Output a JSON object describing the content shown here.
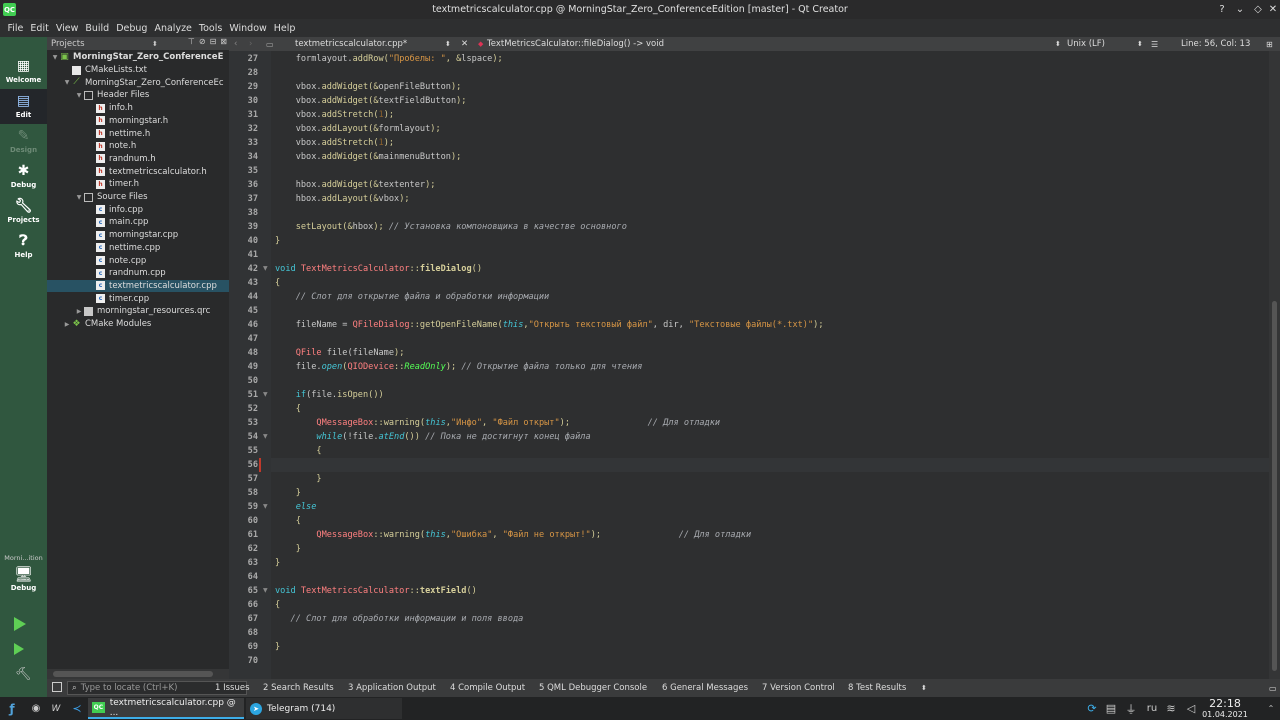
{
  "window": {
    "title": "textmetricscalculator.cpp @ MorningStar_Zero_ConferenceEdition [master] - Qt Creator",
    "app_icon": "qt-creator-icon"
  },
  "menu": [
    "File",
    "Edit",
    "View",
    "Build",
    "Debug",
    "Analyze",
    "Tools",
    "Window",
    "Help"
  ],
  "modes": [
    {
      "label": "Welcome",
      "icon": "grid-icon",
      "state": "normal"
    },
    {
      "label": "Edit",
      "icon": "document-icon",
      "state": "active"
    },
    {
      "label": "Design",
      "icon": "pen-icon",
      "state": "disabled"
    },
    {
      "label": "Debug",
      "icon": "bug-icon",
      "state": "normal"
    },
    {
      "label": "Projects",
      "icon": "wrench-icon",
      "state": "normal"
    },
    {
      "label": "Help",
      "icon": "help-icon",
      "state": "normal"
    }
  ],
  "kit_selector": {
    "project": "Morni...ition",
    "config": "Debug"
  },
  "projects_panel": {
    "header": "Projects",
    "tree": [
      {
        "label": "MorningStar_Zero_ConferenceE",
        "depth": 0,
        "arrow": "down",
        "icon": "qt-icon",
        "bold": true
      },
      {
        "label": "CMakeLists.txt",
        "depth": 1,
        "arrow": "",
        "icon": "cmake-file"
      },
      {
        "label": "MorningStar_Zero_ConferenceEc",
        "depth": 1,
        "arrow": "down",
        "icon": "target"
      },
      {
        "label": "Header Files",
        "depth": 2,
        "arrow": "down",
        "icon": "folder"
      },
      {
        "label": "info.h",
        "depth": 3,
        "arrow": "",
        "icon": "h"
      },
      {
        "label": "morningstar.h",
        "depth": 3,
        "arrow": "",
        "icon": "h"
      },
      {
        "label": "nettime.h",
        "depth": 3,
        "arrow": "",
        "icon": "h"
      },
      {
        "label": "note.h",
        "depth": 3,
        "arrow": "",
        "icon": "h"
      },
      {
        "label": "randnum.h",
        "depth": 3,
        "arrow": "",
        "icon": "h"
      },
      {
        "label": "textmetricscalculator.h",
        "depth": 3,
        "arrow": "",
        "icon": "h"
      },
      {
        "label": "timer.h",
        "depth": 3,
        "arrow": "",
        "icon": "h"
      },
      {
        "label": "Source Files",
        "depth": 2,
        "arrow": "down",
        "icon": "folder"
      },
      {
        "label": "info.cpp",
        "depth": 3,
        "arrow": "",
        "icon": "c"
      },
      {
        "label": "main.cpp",
        "depth": 3,
        "arrow": "",
        "icon": "c"
      },
      {
        "label": "morningstar.cpp",
        "depth": 3,
        "arrow": "",
        "icon": "c"
      },
      {
        "label": "nettime.cpp",
        "depth": 3,
        "arrow": "",
        "icon": "c"
      },
      {
        "label": "note.cpp",
        "depth": 3,
        "arrow": "",
        "icon": "c"
      },
      {
        "label": "randnum.cpp",
        "depth": 3,
        "arrow": "",
        "icon": "c"
      },
      {
        "label": "textmetricscalculator.cpp",
        "depth": 3,
        "arrow": "",
        "icon": "c",
        "selected": true
      },
      {
        "label": "timer.cpp",
        "depth": 3,
        "arrow": "",
        "icon": "c"
      },
      {
        "label": "morningstar_resources.qrc",
        "depth": 2,
        "arrow": "right",
        "icon": "qrc"
      },
      {
        "label": "CMake Modules",
        "depth": 1,
        "arrow": "right",
        "icon": "cmake-modules"
      }
    ]
  },
  "editor": {
    "file_tab": "textmetricscalculator.cpp*",
    "symbol": "TextMetricsCalculator::fileDialog() -> void",
    "encoding": "Unix (LF)",
    "position": "Line: 56, Col: 13",
    "current_line": 56,
    "fold_markers": {
      "42": "open",
      "51": "open",
      "54": "open",
      "59": "open",
      "65": "open"
    },
    "lines": [
      {
        "n": 27,
        "t": [
          [
            "    formlayout.",
            "f"
          ],
          [
            "addRow",
            "fn"
          ],
          [
            "(",
            "pn"
          ],
          [
            "\"Пробелы: \"",
            "st"
          ],
          [
            ", &",
            "pn"
          ],
          [
            "lspace",
            "f"
          ],
          [
            ");",
            "pn"
          ]
        ]
      },
      {
        "n": 28,
        "t": []
      },
      {
        "n": 29,
        "t": [
          [
            "    vbox.",
            "f"
          ],
          [
            "addWidget",
            "fn"
          ],
          [
            "(&",
            "pn"
          ],
          [
            "openFileButton",
            "f"
          ],
          [
            ");",
            "pn"
          ]
        ]
      },
      {
        "n": 30,
        "t": [
          [
            "    vbox.",
            "f"
          ],
          [
            "addWidget",
            "fn"
          ],
          [
            "(&",
            "pn"
          ],
          [
            "textFieldButton",
            "f"
          ],
          [
            ");",
            "pn"
          ]
        ]
      },
      {
        "n": 31,
        "t": [
          [
            "    vbox.",
            "f"
          ],
          [
            "addStretch",
            "fn"
          ],
          [
            "(",
            "pn"
          ],
          [
            "1",
            "num"
          ],
          [
            ");",
            "pn"
          ]
        ]
      },
      {
        "n": 32,
        "t": [
          [
            "    vbox.",
            "f"
          ],
          [
            "addLayout",
            "fn"
          ],
          [
            "(&",
            "pn"
          ],
          [
            "formlayout",
            "f"
          ],
          [
            ");",
            "pn"
          ]
        ]
      },
      {
        "n": 33,
        "t": [
          [
            "    vbox.",
            "f"
          ],
          [
            "addStretch",
            "fn"
          ],
          [
            "(",
            "pn"
          ],
          [
            "1",
            "num"
          ],
          [
            ");",
            "pn"
          ]
        ]
      },
      {
        "n": 34,
        "t": [
          [
            "    vbox.",
            "f"
          ],
          [
            "addWidget",
            "fn"
          ],
          [
            "(&",
            "pn"
          ],
          [
            "mainmenuButton",
            "f"
          ],
          [
            ");",
            "pn"
          ]
        ]
      },
      {
        "n": 35,
        "t": []
      },
      {
        "n": 36,
        "t": [
          [
            "    hbox.",
            "f"
          ],
          [
            "addWidget",
            "fn"
          ],
          [
            "(&",
            "pn"
          ],
          [
            "textenter",
            "f"
          ],
          [
            ");",
            "pn"
          ]
        ]
      },
      {
        "n": 37,
        "t": [
          [
            "    hbox.",
            "f"
          ],
          [
            "addLayout",
            "fn"
          ],
          [
            "(&",
            "pn"
          ],
          [
            "vbox",
            "f"
          ],
          [
            ");",
            "pn"
          ]
        ]
      },
      {
        "n": 38,
        "t": []
      },
      {
        "n": 39,
        "t": [
          [
            "    ",
            "pn"
          ],
          [
            "setLayout",
            "fn"
          ],
          [
            "(&",
            "pn"
          ],
          [
            "hbox",
            "f"
          ],
          [
            "); ",
            "pn"
          ],
          [
            "// Установка компоновщика в качестве основного",
            "cm"
          ]
        ]
      },
      {
        "n": 40,
        "t": [
          [
            "}",
            "pn"
          ]
        ]
      },
      {
        "n": 41,
        "t": []
      },
      {
        "n": 42,
        "t": [
          [
            "void ",
            "kw"
          ],
          [
            "TextMetricsCalculator",
            "ty"
          ],
          [
            "::",
            "pn"
          ],
          [
            "fileDialog",
            "fnb"
          ],
          [
            "()",
            "pn"
          ]
        ]
      },
      {
        "n": 43,
        "t": [
          [
            "{",
            "pn"
          ]
        ]
      },
      {
        "n": 44,
        "t": [
          [
            "    ",
            "pn"
          ],
          [
            "// Слот для открытие файла и обработки информации",
            "cm"
          ]
        ]
      },
      {
        "n": 45,
        "t": []
      },
      {
        "n": 46,
        "t": [
          [
            "    fileName = ",
            "f"
          ],
          [
            "QFileDialog",
            "ty"
          ],
          [
            "::",
            "pn"
          ],
          [
            "getOpenFileName",
            "fn"
          ],
          [
            "(",
            "pn"
          ],
          [
            "this",
            "kwi"
          ],
          [
            ",",
            "pn"
          ],
          [
            "\"Открыть текстовый файл\"",
            "st"
          ],
          [
            ", dir, ",
            "f"
          ],
          [
            "\"Текстовые файлы(*.txt)\"",
            "st"
          ],
          [
            ");",
            "pn"
          ]
        ]
      },
      {
        "n": 47,
        "t": []
      },
      {
        "n": 48,
        "t": [
          [
            "    ",
            "pn"
          ],
          [
            "QFile",
            "ty"
          ],
          [
            " file(",
            "f"
          ],
          [
            "fileName",
            "f"
          ],
          [
            ");",
            "pn"
          ]
        ]
      },
      {
        "n": 49,
        "t": [
          [
            "    file.",
            "f"
          ],
          [
            "open",
            "kwi"
          ],
          [
            "(",
            "pn"
          ],
          [
            "QIODevice",
            "ty"
          ],
          [
            "::",
            "pn"
          ],
          [
            "ReadOnly",
            "en"
          ],
          [
            "); ",
            "pn"
          ],
          [
            "// Открытие файла только для чтения",
            "cm"
          ]
        ]
      },
      {
        "n": 50,
        "t": []
      },
      {
        "n": 51,
        "t": [
          [
            "    ",
            "pn"
          ],
          [
            "if",
            "kw"
          ],
          [
            "(file.",
            "f"
          ],
          [
            "isOpen",
            "fn"
          ],
          [
            "())",
            "pn"
          ]
        ]
      },
      {
        "n": 52,
        "t": [
          [
            "    {",
            "pn"
          ]
        ]
      },
      {
        "n": 53,
        "t": [
          [
            "        ",
            "pn"
          ],
          [
            "QMessageBox",
            "ty"
          ],
          [
            "::",
            "pn"
          ],
          [
            "warning",
            "fn"
          ],
          [
            "(",
            "pn"
          ],
          [
            "this",
            "kwi"
          ],
          [
            ",",
            "pn"
          ],
          [
            "\"Инфо\"",
            "st"
          ],
          [
            ", ",
            "pn"
          ],
          [
            "\"Файл открыт\"",
            "st"
          ],
          [
            ");               ",
            "pn"
          ],
          [
            "// Для отладки",
            "cm"
          ]
        ]
      },
      {
        "n": 54,
        "t": [
          [
            "        ",
            "pn"
          ],
          [
            "while",
            "kwi"
          ],
          [
            "(!file.",
            "f"
          ],
          [
            "atEnd",
            "kwi"
          ],
          [
            "()) ",
            "pn"
          ],
          [
            "// Пока не достигнут конец файла",
            "cm"
          ]
        ]
      },
      {
        "n": 55,
        "t": [
          [
            "        {",
            "pn"
          ]
        ]
      },
      {
        "n": 56,
        "t": []
      },
      {
        "n": 57,
        "t": [
          [
            "        }",
            "pn"
          ]
        ]
      },
      {
        "n": 58,
        "t": [
          [
            "    }",
            "pn"
          ]
        ]
      },
      {
        "n": 59,
        "t": [
          [
            "    ",
            "pn"
          ],
          [
            "else",
            "kwi"
          ]
        ]
      },
      {
        "n": 60,
        "t": [
          [
            "    {",
            "pn"
          ]
        ]
      },
      {
        "n": 61,
        "t": [
          [
            "        ",
            "pn"
          ],
          [
            "QMessageBox",
            "ty"
          ],
          [
            "::",
            "pn"
          ],
          [
            "warning",
            "fn"
          ],
          [
            "(",
            "pn"
          ],
          [
            "this",
            "kwi"
          ],
          [
            ",",
            "pn"
          ],
          [
            "\"Ошибка\"",
            "st"
          ],
          [
            ", ",
            "pn"
          ],
          [
            "\"Файл не открыт!\"",
            "st"
          ],
          [
            ");               ",
            "pn"
          ],
          [
            "// Для отладки",
            "cm"
          ]
        ]
      },
      {
        "n": 62,
        "t": [
          [
            "    }",
            "pn"
          ]
        ]
      },
      {
        "n": 63,
        "t": [
          [
            "}",
            "pn"
          ]
        ]
      },
      {
        "n": 64,
        "t": []
      },
      {
        "n": 65,
        "t": [
          [
            "void ",
            "kw"
          ],
          [
            "TextMetricsCalculator",
            "ty"
          ],
          [
            "::",
            "pn"
          ],
          [
            "textField",
            "fnb"
          ],
          [
            "()",
            "pn"
          ]
        ]
      },
      {
        "n": 66,
        "t": [
          [
            "{",
            "pn"
          ]
        ]
      },
      {
        "n": 67,
        "t": [
          [
            "   ",
            "pn"
          ],
          [
            "// Слот для обработки информации и поля ввода",
            "cm"
          ]
        ]
      },
      {
        "n": 68,
        "t": []
      },
      {
        "n": 69,
        "t": [
          [
            "}",
            "pn"
          ]
        ]
      },
      {
        "n": 70,
        "t": []
      }
    ]
  },
  "output_bar": {
    "locator_placeholder": "Type to locate (Ctrl+K)",
    "tabs": [
      "1 Issues",
      "2 Search Results",
      "3 Application Output",
      "4 Compile Output",
      "5 QML Debugger Console",
      "6 General Messages",
      "7 Version Control",
      "8 Test Results"
    ]
  },
  "taskbar": {
    "tasks": [
      {
        "label": "textmetricscalculator.cpp @ ...",
        "active": true
      },
      {
        "label": "Telegram (714)",
        "active": false
      }
    ],
    "language": "ru",
    "time": "22:18",
    "date": "01.04.2021"
  },
  "colors": {
    "mode_bar": "#30573f",
    "editor_bg": "#2e2f30",
    "selection": "#285263",
    "accent": "#3daee9"
  }
}
